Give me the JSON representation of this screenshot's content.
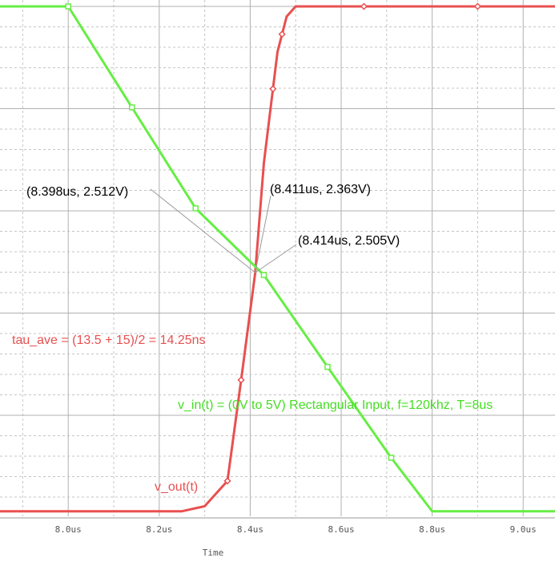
{
  "chart_data": {
    "type": "line",
    "xlabel": "Time",
    "ylabel": "",
    "xlim": [
      7.85,
      9.07
    ],
    "ylim": [
      -0.05,
      5.0
    ],
    "x_tick_labels": [
      "8.0us",
      "8.2us",
      "8.4us",
      "8.6us",
      "8.8us",
      "9.0us"
    ],
    "x_ticks": [
      8.0,
      8.2,
      8.4,
      8.6,
      8.8,
      9.0
    ],
    "grid": true,
    "series": [
      {
        "name": "v_out(t)",
        "color": "#e85050",
        "x": [
          7.85,
          8.0,
          8.1,
          8.2,
          8.25,
          8.3,
          8.35,
          8.38,
          8.411,
          8.43,
          8.46,
          8.48,
          8.5,
          8.55,
          8.65,
          8.8,
          8.9,
          9.07
        ],
        "y": [
          0.0,
          0.0,
          0.0,
          0.0,
          0.0,
          0.05,
          0.3,
          1.3,
          2.363,
          3.45,
          4.55,
          4.9,
          5.0,
          5.0,
          5.0,
          5.0,
          5.0,
          5.0
        ],
        "markers_x": [
          8.35,
          8.38,
          8.45,
          8.47,
          8.65,
          8.9
        ]
      },
      {
        "name": "v_in(t)",
        "color": "#66ee44",
        "x": [
          7.85,
          7.9,
          8.0,
          8.14,
          8.28,
          8.43,
          8.57,
          8.71,
          8.8,
          8.9,
          9.07
        ],
        "y": [
          5.0,
          5.0,
          5.0,
          4.0,
          3.0,
          2.34,
          1.43,
          0.53,
          0.0,
          0.0,
          0.0
        ],
        "markers_x": [
          8.0,
          8.14,
          8.28,
          8.43,
          8.57,
          8.71
        ]
      }
    ],
    "annotations": [
      {
        "text": "(8.398us, 2.512V)",
        "x": 8.398,
        "y": 2.512,
        "color": "#000000"
      },
      {
        "text": "(8.411us, 2.363V)",
        "x": 8.411,
        "y": 2.363,
        "color": "#000000"
      },
      {
        "text": "(8.414us, 2.505V)",
        "x": 8.414,
        "y": 2.505,
        "color": "#000000"
      },
      {
        "text": "tau_ave = (13.5 + 15)/2 = 14.25ns",
        "color": "#e85050"
      },
      {
        "text": "v_in(t) = (0V to 5V) Rectangular Input, f=120khz, T=8us",
        "color": "#44dd22"
      },
      {
        "text": "v_out(t)",
        "color": "#e85050"
      }
    ]
  }
}
